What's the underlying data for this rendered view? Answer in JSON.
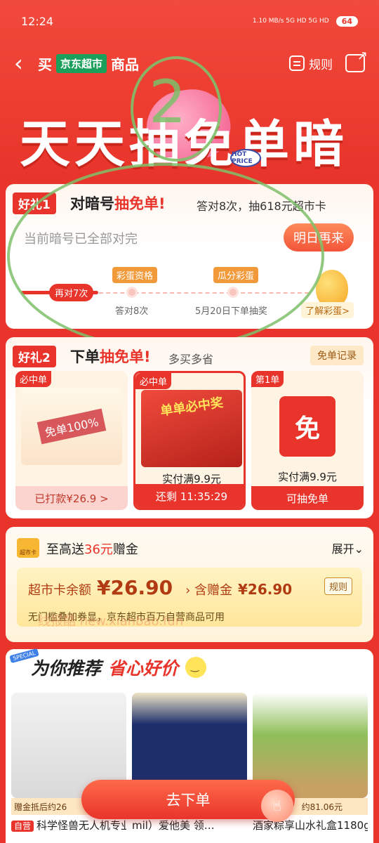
{
  "status_bar": {
    "time": "12:24",
    "network": "1.10 MB/s  5G HD  5G HD",
    "battery": "64"
  },
  "nav": {
    "back_icon": "chevron-left-icon",
    "prefix": "买",
    "badge": "京东超市",
    "suffix": "商品",
    "rules": "规则",
    "share_icon": "share-icon"
  },
  "banner": {
    "text": "天天抽免单暗",
    "hot_price": "HOT PRICE"
  },
  "gift1": {
    "tag": "好礼1",
    "title_a": "对暗号",
    "title_b": "抽免单",
    "title_c": "!",
    "subtitle": "答对8次，抽618元超市卡",
    "status": "当前暗号已全部对完",
    "button": "明日再来",
    "progress_pill": "再对7次",
    "node1_tag": "彩蛋资格",
    "node1_label": "答对8次",
    "node2_tag": "瓜分彩蛋",
    "node2_label": "5月20日下单抽奖",
    "egg_link": "了解彩蛋>"
  },
  "gift2": {
    "tag": "好礼2",
    "title_a": "下单",
    "title_b": "抽免单",
    "title_c": "!",
    "subtitle": "多买多省",
    "record": "免单记录",
    "products": [
      {
        "tag": "必中单",
        "img_text": "免单100%",
        "price": "",
        "footer": "已打款¥26.9 >"
      },
      {
        "tag": "必中单",
        "img_text": "单单必中奖",
        "price": "实付满9.9元",
        "footer": "还剩 11:35:29"
      },
      {
        "tag": "第1单",
        "img_text": "免",
        "price": "实付满9.9元",
        "footer": "可抽免单"
      }
    ]
  },
  "gift3": {
    "card_icon_label": "超市卡",
    "title_a": "至高送",
    "title_b": "36元",
    "title_c": "赠金",
    "expand": "展开⌄",
    "balance_label": "超市卡余额",
    "balance_value": "¥26.90",
    "bonus_label": "› 含赠金",
    "bonus_value": "¥26.90",
    "rules": "规则",
    "note": "无门槛叠加券显，京东超市百万自营商品可用"
  },
  "watermark": "线报酷 new.xianbao.fun",
  "recommend": {
    "special": "SPECIAL",
    "title": "为你推荐",
    "slogan": "省心好价",
    "items": [
      {
        "band": "赠金抵后约26",
        "self": "自营",
        "name": "科学怪兽无人机专业航…"
      },
      {
        "band": "",
        "self": "",
        "name": "mil）爱他美 领…"
      },
      {
        "band": "约81.06元",
        "self": "",
        "name": "酒家粽享山水礼盒1180g…"
      }
    ]
  },
  "cta": {
    "label": "去下单"
  },
  "colors": {
    "brand_red": "#e8342b",
    "jd_green": "#1aa05a",
    "annotation_green": "#7ec06a"
  }
}
